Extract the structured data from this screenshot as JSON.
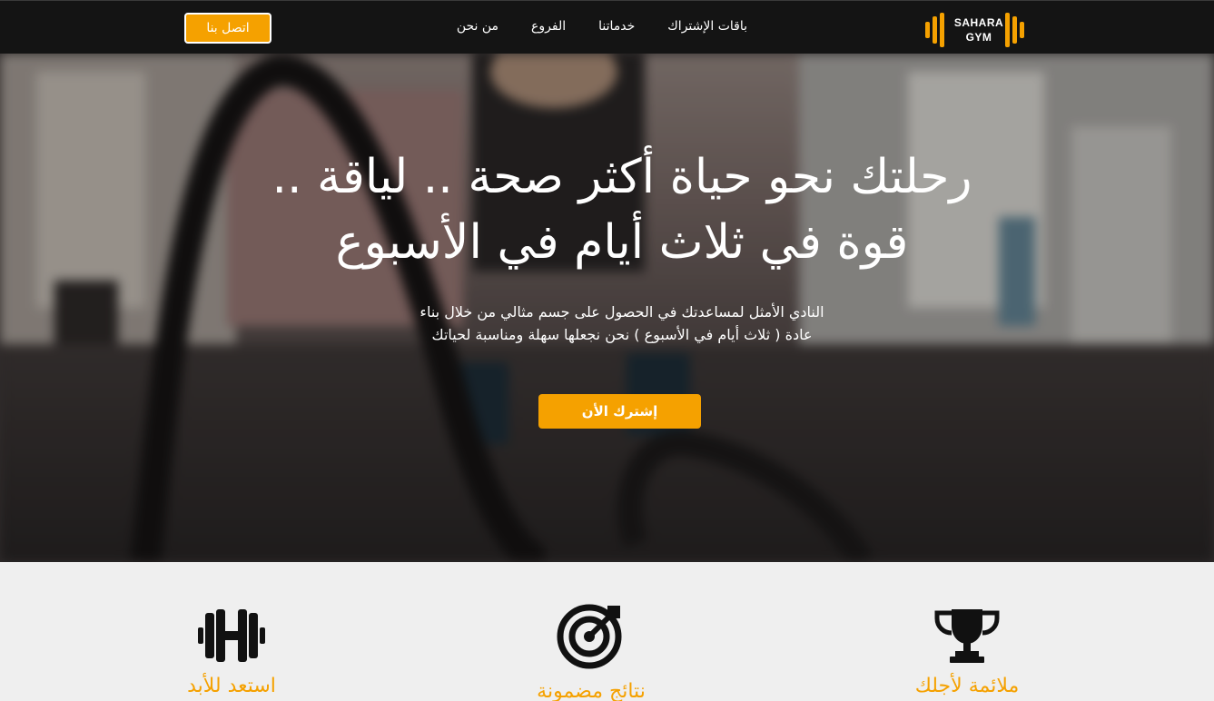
{
  "header": {
    "logo_line1": "SAHARA",
    "logo_line2": "GYM",
    "nav": [
      {
        "label": "باقات الإشتراك"
      },
      {
        "label": "خدماتنا"
      },
      {
        "label": "الفروع"
      },
      {
        "label": "من نحن"
      }
    ],
    "contact_label": "اتصل بنا"
  },
  "hero": {
    "title_line1": "رحلتك نحو حياة أكثر صحة .. لياقة ..",
    "title_line2": "قوة في ثلاث أيام في الأسبوع",
    "subtitle_line1": "النادي الأمثل لمساعدتك في الحصول على جسم مثالي من خلال بناء",
    "subtitle_line2": "عادة ( ثلاث أيام في الأسبوع ) نحن نجعلها سهلة ومناسبة لحياتك",
    "cta_label": "إشترك الأن"
  },
  "features": [
    {
      "icon": "trophy-icon",
      "title": "ملائمة لأجلك"
    },
    {
      "icon": "target-icon",
      "title": "نتائج مضمونة"
    },
    {
      "icon": "dumbbell-icon",
      "title": "استعد للأبد"
    }
  ],
  "colors": {
    "accent": "#f5a100",
    "header_bg": "#141414",
    "section_bg": "#efefef",
    "text_light": "#ffffff"
  }
}
